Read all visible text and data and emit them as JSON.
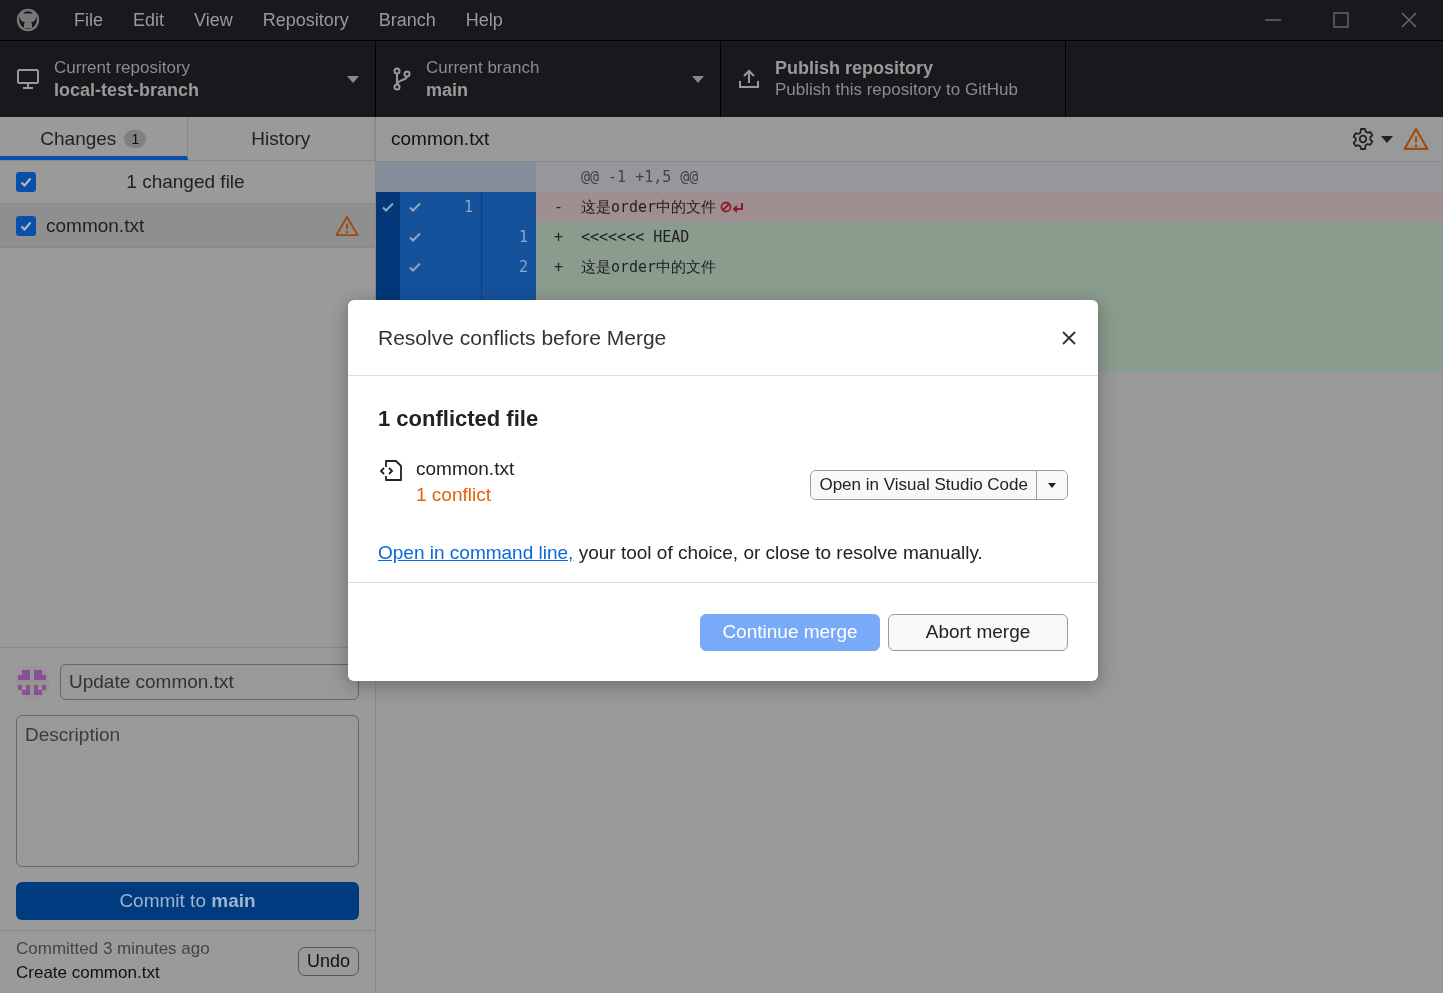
{
  "menu": [
    "File",
    "Edit",
    "View",
    "Repository",
    "Branch",
    "Help"
  ],
  "toolbar": {
    "repository": {
      "label": "Current repository",
      "value": "local-test-branch"
    },
    "branch": {
      "label": "Current branch",
      "value": "main"
    },
    "publish": {
      "title": "Publish repository",
      "subtitle": "Publish this repository to GitHub"
    }
  },
  "sidebar": {
    "tabs": [
      {
        "label": "Changes",
        "badge": "1",
        "selected": true
      },
      {
        "label": "History",
        "selected": false
      }
    ],
    "select_all": {
      "label": "1 changed file",
      "checked": true
    },
    "files": [
      {
        "name": "common.txt",
        "checked": true,
        "conflicted": true
      }
    ]
  },
  "commit": {
    "summary": "Update common.txt",
    "description_placeholder": "Description",
    "button": "Commit to **main**",
    "last_commit": {
      "time": "Committed 3 minutes ago",
      "message": "Create common.txt",
      "undo": "Undo"
    }
  },
  "diff": {
    "file": "common.txt",
    "hunk": "@@ -1 +1,5 @@",
    "lines": [
      {
        "kind": "removed",
        "old": "1",
        "sign": "-",
        "text": "这是order中的文件",
        "checked": true,
        "hunk_checked": true,
        "no_newline": true
      },
      {
        "kind": "added",
        "new": "1",
        "sign": "+",
        "text": "<<<<<<< HEAD",
        "checked": true,
        "hunk_checked": false,
        "no_newline": false
      },
      {
        "kind": "added",
        "new": "2",
        "sign": "+",
        "text": "这是order中的文件",
        "checked": true,
        "hunk_checked": false,
        "no_newline": false
      }
    ]
  },
  "dialog": {
    "title": "Resolve conflicts before Merge",
    "heading": "1 conflicted file",
    "files": [
      {
        "name": "common.txt",
        "status": "1 conflict",
        "open_button": "Open in Visual Studio Code"
      }
    ],
    "hint": {
      "link": "Open in command line,",
      "text": "your tool of choice, or close to resolve manually."
    },
    "buttons": [
      {
        "label": "Continue merge",
        "kind": "primary",
        "disabled": true
      },
      {
        "label": "Abort merge",
        "kind": "secondary",
        "disabled": false
      }
    ]
  }
}
